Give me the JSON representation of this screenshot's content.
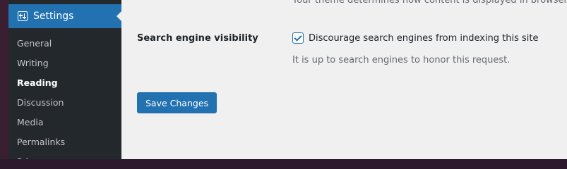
{
  "sidebar": {
    "menu_title": "Settings",
    "items": [
      {
        "label": "General"
      },
      {
        "label": "Writing"
      },
      {
        "label": "Reading"
      },
      {
        "label": "Discussion"
      },
      {
        "label": "Media"
      },
      {
        "label": "Permalinks"
      },
      {
        "label": "Privacy"
      }
    ],
    "current": "Reading"
  },
  "main": {
    "top_partial_text": "Your theme determines how content is displayed in browsers.",
    "search_visibility": {
      "label": "Search engine visibility",
      "checkbox_label": "Discourage search engines from indexing this site",
      "checked": true,
      "description": "It is up to search engines to honor this request."
    },
    "save_button": "Save Changes"
  },
  "colors": {
    "accent": "#2271b1",
    "sidebar_bg": "#23282d",
    "content_bg": "#f0f0f1"
  }
}
